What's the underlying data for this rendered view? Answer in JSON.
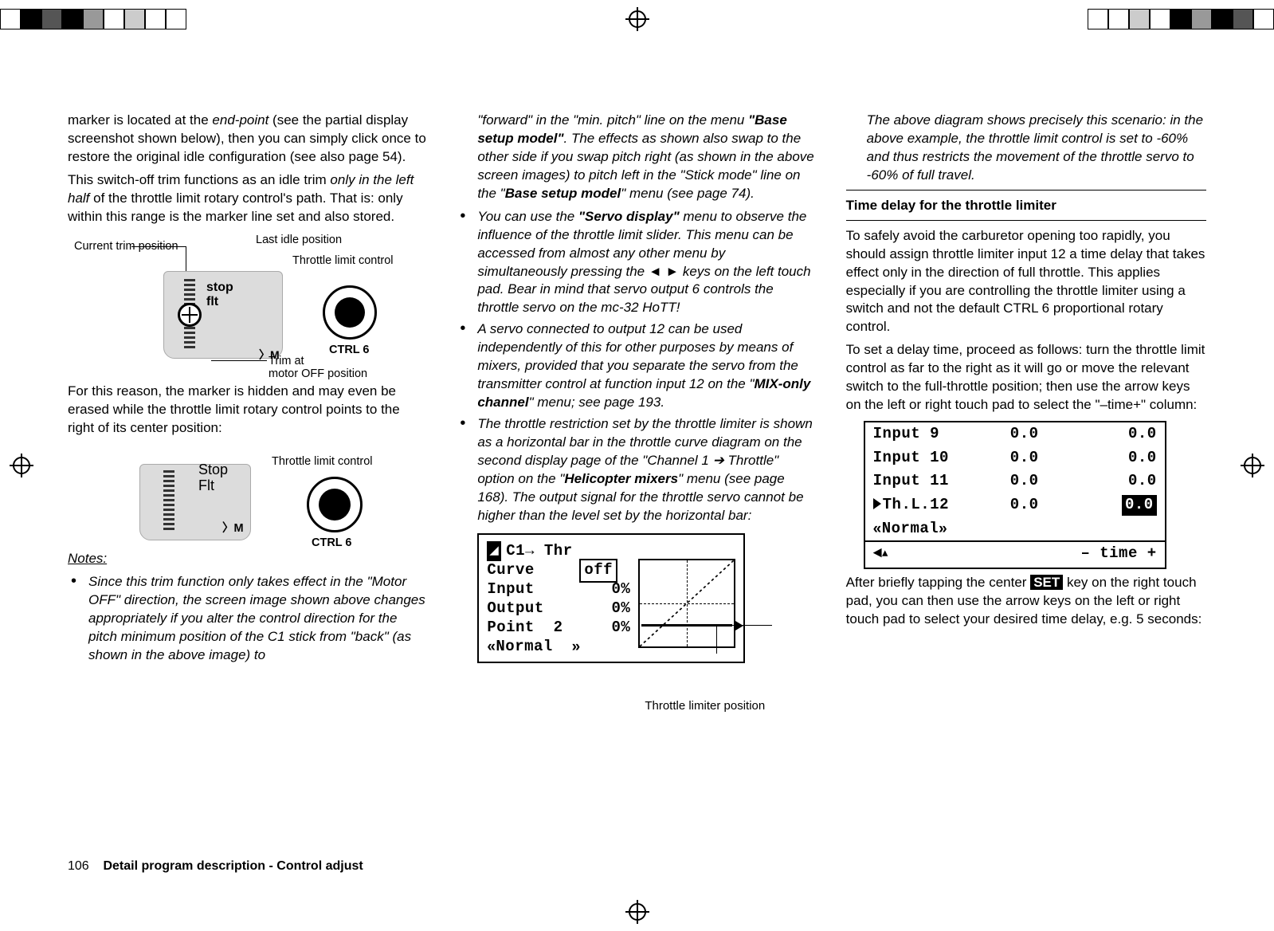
{
  "col1": {
    "p1_a": "marker is located at the ",
    "p1_b": "end-point",
    "p1_c": " (see the partial display screenshot shown below), then you can simply click once to restore the original idle configuration (see also page 54).",
    "p2_a": "This switch-off trim functions as an idle trim ",
    "p2_b": "only in the left half",
    "p2_c": " of the throttle limit rotary control's path. That is: only within this range is the marker line set and also stored.",
    "diag1": {
      "current": "Current trim position",
      "last": "Last idle position",
      "tlc": "Throttle limit control",
      "stop": "stop",
      "flt": "flt",
      "ctrl": "CTRL 6",
      "trim1": "Trim at",
      "trim2": "motor OFF position",
      "m": "M"
    },
    "p3": "For this reason, the marker is hidden and may even be erased while the throttle limit rotary control points to the right of its center position:",
    "diag2": {
      "stop": "Stop",
      "flt": "Flt",
      "tlc": "Throttle limit control",
      "ctrl": "CTRL 6",
      "m": "M"
    },
    "notes": "Notes:",
    "note1_a": "Since this trim function only takes effect in the \"Motor OFF\" direction, the screen image shown above changes appropriately if you alter the control direction for the pitch minimum position of the C1 stick from \"back\" (as shown in the above image) to"
  },
  "col2": {
    "cont_a": "\"forward\" in the \"min. pitch\" line on the menu ",
    "cont_b": "\"Base setup model\"",
    "cont_c": ". The effects as shown also swap to the other side if you swap pitch right (as shown in the above screen images) to pitch left in the \"Stick mode\" line on the \"",
    "cont_d": "Base setup model",
    "cont_e": "\" menu (see page 74).",
    "b2_a": "You can use the ",
    "b2_b": "\"Servo display\"",
    "b2_c": " menu to observe the influence of the throttle limit slider. This menu can be accessed from almost any other menu by simultaneously pressing the ◄ ► keys on the left touch pad. Bear in mind that servo output 6 controls the throttle servo on the mc-32 HoTT!",
    "b3_a": "A servo connected to output 12 can be used independently of this for other purposes by means of mixers, provided that you separate the servo from the transmitter control at function input 12 on the \"",
    "b3_b": "MIX-only channel",
    "b3_c": "\" menu; see page 193.",
    "b4_a": "The throttle restriction set by the throttle limiter is shown as a horizontal bar in the throttle curve diagram on the second display page of the \"Channel 1 ➔ Throttle\" option on the \"",
    "b4_b": "Helicopter mixers",
    "b4_c": "\" menu (see page 168). The output signal for the throttle servo cannot be higher than the level set by the horizontal bar:",
    "lcd": {
      "row0": "C1→ Thr",
      "curve": "Curve",
      "off": "off",
      "input": "Input",
      "inputv": "0%",
      "output": "Output",
      "outputv": "0%",
      "point": "Point",
      "pointn": "2",
      "pointv": "0%",
      "normal": "Normal"
    },
    "ptr": "Throttle limiter position"
  },
  "col3": {
    "top": "The above diagram shows precisely this scenario: in the above example, the throttle limit control is set to -60% and thus restricts the movement of the throttle servo to -60% of full travel.",
    "h": "Time delay for the throttle limiter",
    "p1": "To safely avoid the carburetor opening too rapidly, you should assign throttle limiter input 12 a time delay that takes effect only in the direction of full throttle. This applies especially if you are controlling the throttle limiter using a switch and not the default CTRL 6 proportional rotary control.",
    "p2": "To set a delay time, proceed as follows: turn the throttle limit control as far to the right as it will go or move the relevant switch to the full-throttle position; then use the arrow keys on the left or right touch pad to select the \"–time+\" column:",
    "lcd2": {
      "r1c1": "Input  9",
      "r1c2": "0.0",
      "r1c3": "0.0",
      "r2c1": "Input 10",
      "r2c2": "0.0",
      "r2c3": "0.0",
      "r3c1": "Input 11",
      "r3c2": "0.0",
      "r3c3": "0.0",
      "r4c1": "Th.L.12",
      "r4c2": "0.0",
      "r4c3": "0.0",
      "normal": "Normal",
      "time": "– time +"
    },
    "after_a": "After briefly tapping the center ",
    "after_set": "SET",
    "after_b": " key on the right touch pad, you can then use the arrow keys on the left or right touch pad to select your desired time delay, e.g. 5 seconds:"
  },
  "footer": {
    "page": "106",
    "title": "Detail program description - Control adjust"
  }
}
